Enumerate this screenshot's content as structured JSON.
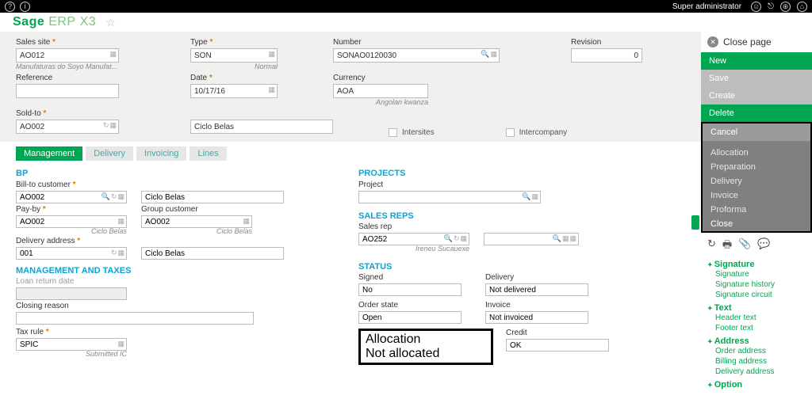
{
  "topbar": {
    "user": "Super administrator"
  },
  "brand": {
    "sage": "Sage",
    "erp": "ERP",
    "x3": "X3"
  },
  "header_form": {
    "sales_site": {
      "label": "Sales site",
      "value": "AO012",
      "desc": "Manufaturas do Soyo Manufat..."
    },
    "reference": {
      "label": "Reference",
      "value": ""
    },
    "sold_to": {
      "label": "Sold-to",
      "value": "AO002"
    },
    "type": {
      "label": "Type",
      "value": "SON",
      "desc": "Normal"
    },
    "date": {
      "label": "Date",
      "value": "10/17/16"
    },
    "customer_name": "Ciclo Belas",
    "number": {
      "label": "Number",
      "value": "SONAO0120030"
    },
    "currency": {
      "label": "Currency",
      "value": "AOA",
      "desc": "Angolan kwanza"
    },
    "revision": {
      "label": "Revision",
      "value": "0"
    },
    "intersites": "Intersites",
    "intercompany": "Intercompany"
  },
  "tabs": [
    "Management",
    "Delivery",
    "Invoicing",
    "Lines"
  ],
  "bp": {
    "title": "BP",
    "bill_to": {
      "label": "Bill-to customer",
      "value": "AO002",
      "desc": "Ciclo Belas",
      "desc2": "Ciclo Belas"
    },
    "pay_by": {
      "label": "Pay-by",
      "value": "AO002"
    },
    "group_customer": {
      "label": "Group customer",
      "value": "AO002",
      "desc": "Ciclo Belas"
    },
    "delivery_addr": {
      "label": "Delivery address",
      "value": "001",
      "desc2": "Ciclo Belas"
    }
  },
  "mgmt_taxes": {
    "title": "MANAGEMENT AND TAXES",
    "loan_return": {
      "label": "Loan return date",
      "value": ""
    },
    "closing_reason": {
      "label": "Closing reason",
      "value": ""
    },
    "tax_rule": {
      "label": "Tax rule",
      "value": "SPIC",
      "desc": "Submitted IC"
    }
  },
  "projects": {
    "title": "PROJECTS",
    "project": {
      "label": "Project",
      "value": ""
    }
  },
  "salesreps": {
    "title": "SALES REPS",
    "rep": {
      "label": "Sales rep",
      "value": "AO252",
      "desc": "Ireneu Sucauexe"
    }
  },
  "status": {
    "title": "STATUS",
    "signed": {
      "label": "Signed",
      "value": "No"
    },
    "order_state": {
      "label": "Order state",
      "value": "Open"
    },
    "delivery": {
      "label": "Delivery",
      "value": "Not delivered"
    },
    "invoice": {
      "label": "Invoice",
      "value": "Not invoiced"
    },
    "allocation": {
      "label": "Allocation",
      "value": "Not allocated"
    },
    "credit": {
      "label": "Credit",
      "value": "OK"
    }
  },
  "right": {
    "close_page": "Close page",
    "actions": {
      "new": "New",
      "save": "Save",
      "create": "Create",
      "delete": "Delete",
      "cancel": "Cancel"
    },
    "menu": [
      "Allocation",
      "Preparation",
      "Delivery",
      "Invoice",
      "Proforma",
      "Close"
    ],
    "signature": {
      "title": "Signature",
      "items": [
        "Signature",
        "Signature history",
        "Signature circuit"
      ]
    },
    "text": {
      "title": "Text",
      "items": [
        "Header text",
        "Footer text"
      ]
    },
    "address": {
      "title": "Address",
      "items": [
        "Order address",
        "Billing address",
        "Delivery address"
      ]
    },
    "option": {
      "title": "Option"
    }
  }
}
